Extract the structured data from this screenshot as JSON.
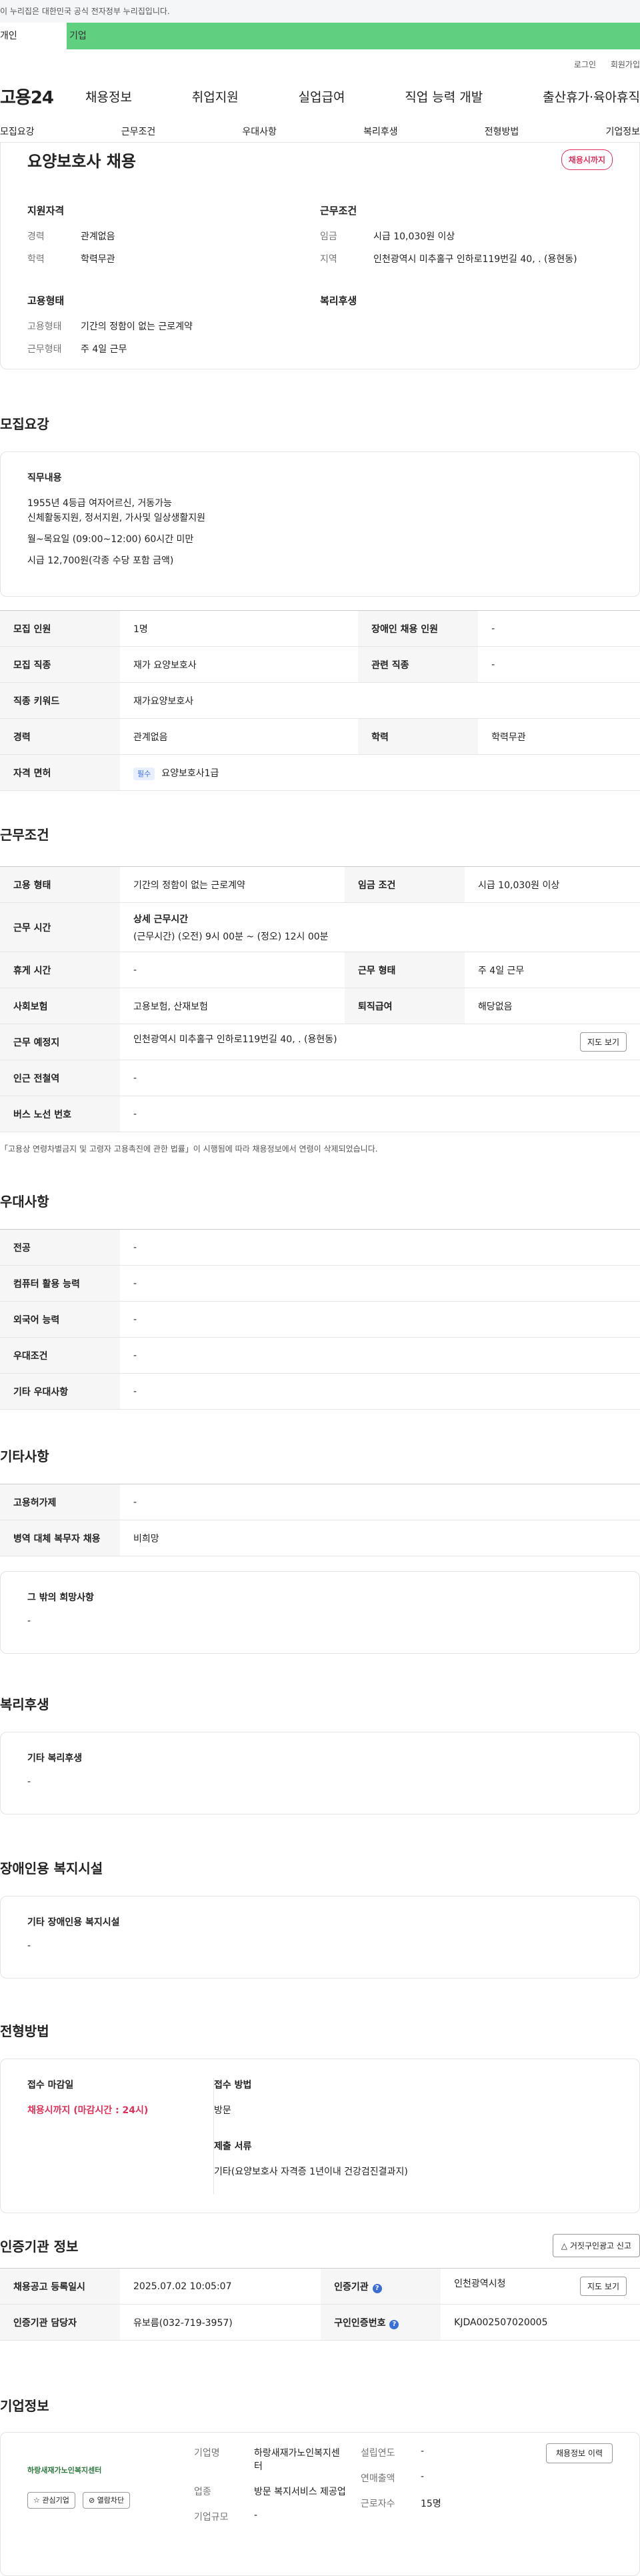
{
  "gov_banner": "이 누리집은 대한민국 공식 전자정부 누리집입니다.",
  "tabs": {
    "personal": "개인",
    "company": "기업"
  },
  "util": {
    "login": "로그인",
    "signup": "회원가입"
  },
  "gnb": {
    "logo": "고용24",
    "menu": [
      "채용정보",
      "취업지원",
      "실업급여",
      "직업 능력 개발",
      "출산휴가·육아휴직"
    ]
  },
  "subnav": [
    "모집요강",
    "근무조건",
    "우대사항",
    "복리후생",
    "전형방법",
    "기업정보"
  ],
  "job": {
    "title": "요양보호사 채용",
    "badge": "채용시까지",
    "qual_title": "지원자격",
    "qual": [
      {
        "k": "경력",
        "v": "관계없음"
      },
      {
        "k": "학력",
        "v": "학력무관"
      }
    ],
    "cond_title": "근무조건",
    "cond": [
      {
        "k": "임금",
        "v": "시급 10,030원 이상"
      },
      {
        "k": "지역",
        "v": "인천광역시 미추홀구 인하로119번길 40, . (용현동)"
      }
    ],
    "emp_title": "고용형태",
    "emp": [
      {
        "k": "고용형태",
        "v": "기간의 정함이 없는 근로계약"
      },
      {
        "k": "근무형태",
        "v": "주 4일 근무"
      }
    ],
    "welfare_title": "복리후생"
  },
  "recruit": {
    "title": "모집요강",
    "duty_label": "직무내용",
    "duty_lines": [
      "1955년 4등급 여자어르신, 거동가능",
      "신체활동지원, 정서지원, 가사및 일상생활지원",
      "월~목요일 (09:00~12:00) 60시간 미만",
      "시급 12,700원(각종 수당 포함 금액)"
    ],
    "rows": [
      {
        "k1": "모집 인원",
        "v1": "1명",
        "k2": "장애인 채용 인원",
        "v2": "-"
      },
      {
        "k1": "모집 직종",
        "v1": "재가 요양보호사",
        "k2": "관련 직종",
        "v2": "-"
      },
      {
        "k1": "직종 키워드",
        "v1": "재가요양보호사"
      },
      {
        "k1": "경력",
        "v1": "관계없음",
        "k2": "학력",
        "v2": "학력무관"
      },
      {
        "k1": "자격 면허",
        "tag": "필수",
        "v1": "요양보호사1급"
      }
    ]
  },
  "work": {
    "title": "근무조건",
    "emp_k": "고용 형태",
    "emp_v": "기간의 정함이 없는 근로계약",
    "wage_k": "임금 조건",
    "wage_v": "시급 10,030원 이상",
    "time_k": "근무 시간",
    "time_label": "상세 근무시간",
    "time_v": "(근무시간) (오전) 9시 00분 ~ (정오) 12시 00분",
    "rest_k": "휴게 시간",
    "rest_v": "-",
    "form_k": "근무 형태",
    "form_v": "주 4일 근무",
    "ins_k": "사회보험",
    "ins_v": "고용보험, 산재보험",
    "sev_k": "퇴직급여",
    "sev_v": "해당없음",
    "place_k": "근무 예정지",
    "place_v": "인천광역시 미추홀구 인하로119번길 40, . (용현동)",
    "map_btn": "지도 보기",
    "sub_k": "인근 전철역",
    "sub_v": "-",
    "bus_k": "버스 노선 번호",
    "bus_v": "-",
    "note": "「고용상 연령차별금지 및 고령자 고용촉진에 관한 법률」이 시행됨에 따라 채용정보에서 연령이 삭제되었습니다."
  },
  "pref": {
    "title": "우대사항",
    "rows": [
      {
        "k": "전공",
        "v": "-"
      },
      {
        "k": "컴퓨터 활용 능력",
        "v": "-"
      },
      {
        "k": "외국어 능력",
        "v": "-"
      },
      {
        "k": "우대조건",
        "v": "-"
      },
      {
        "k": "기타 우대사항",
        "v": "-"
      }
    ]
  },
  "etc": {
    "title": "기타사항",
    "rows": [
      {
        "k": "고용허가제",
        "v": "-"
      },
      {
        "k": "병역 대체 복무자 채용",
        "v": "비희망"
      }
    ],
    "other_label": "그 밖의 희망사항",
    "other_v": "-"
  },
  "welfare": {
    "title": "복리후생",
    "label": "기타 복리후생",
    "v": "-"
  },
  "disabled": {
    "title": "장애인용 복지시설",
    "label": "기타 장애인용 복지시설",
    "v": "-"
  },
  "selection": {
    "title": "전형방법",
    "deadline_label": "접수 마감일",
    "deadline_v": "채용시까지 (마감시간 : 24시)",
    "method_label": "접수 방법",
    "method_v": "방문",
    "docs_label": "제출 서류",
    "docs_v": "기타(요양보호사 자격증 1년이내 건강검진결과지)"
  },
  "cert": {
    "title": "인증기관 정보",
    "report_btn": "거짓구인광고 신고",
    "r1k1": "채용공고 등록일시",
    "r1v1": "2025.07.02 10:05:07",
    "r1k2": "인증기관",
    "r1v2": "인천광역시청",
    "map_btn": "지도 보기",
    "r2k1": "인증기관 담당자",
    "r2v1": "유보름(032-719-3957)",
    "r2k2": "구인인증번호",
    "r2v2": "KJDA002507020005"
  },
  "company": {
    "title": "기업정보",
    "logo_text": "하랑새재가노인복지센터",
    "interest_btn": "관심기업",
    "block_btn": "열람차단",
    "name_k": "기업명",
    "name_v": "하랑새재가노인복지센터",
    "ind_k": "업종",
    "ind_v": "방문 복지서비스 제공업",
    "size_k": "기업규모",
    "size_v": "-",
    "year_k": "설립연도",
    "year_v": "-",
    "sales_k": "연매출액",
    "sales_v": "-",
    "emp_k": "근로자수",
    "emp_v": "15명",
    "history_btn": "채용정보 이력"
  },
  "colors": {
    "accent_green": "#5fcf80",
    "badge_red": "#e0305a",
    "tag_blue": "#3a6fd8"
  }
}
